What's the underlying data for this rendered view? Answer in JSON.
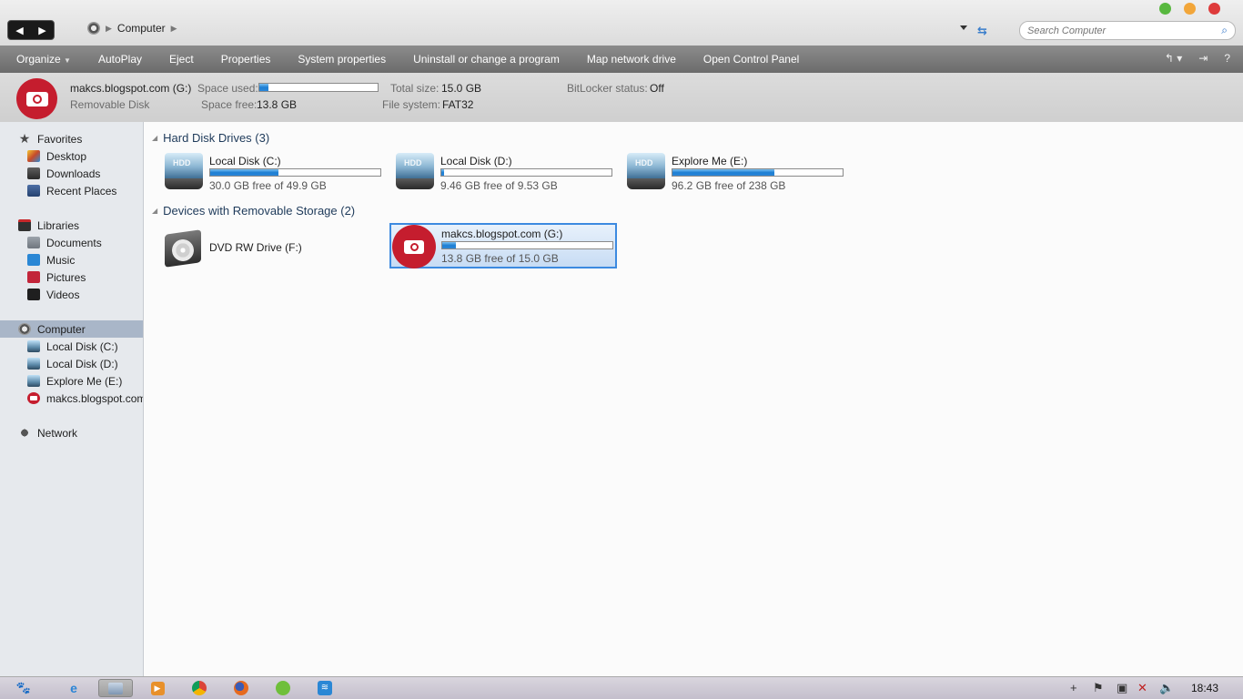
{
  "address": {
    "crumbs": [
      "Computer"
    ]
  },
  "search": {
    "placeholder": "Search Computer"
  },
  "window_buttons": {
    "colors": [
      "#58b83f",
      "#f2a63a",
      "#de3b3b"
    ]
  },
  "commands": [
    "Organize",
    "AutoPlay",
    "Eject",
    "Properties",
    "System properties",
    "Uninstall or change a program",
    "Map network drive",
    "Open Control Panel"
  ],
  "details": {
    "name": "makcs.blogspot.com (G:)",
    "type": "Removable Disk",
    "space_used_label": "Space used:",
    "space_used_fraction": 0.08,
    "space_free_label": "Space free:",
    "space_free_value": "13.8 GB",
    "total_size_label": "Total size:",
    "total_size_value": "15.0 GB",
    "filesystem_label": "File system:",
    "filesystem_value": "FAT32",
    "bitlocker_label": "BitLocker status:",
    "bitlocker_value": "Off"
  },
  "sidebar": {
    "favorites": "Favorites",
    "favorites_items": [
      "Desktop",
      "Downloads",
      "Recent Places"
    ],
    "libraries": "Libraries",
    "libraries_items": [
      "Documents",
      "Music",
      "Pictures",
      "Videos"
    ],
    "computer": "Computer",
    "computer_items": [
      "Local Disk (C:)",
      "Local Disk (D:)",
      "Explore Me (E:)",
      "makcs.blogspot.com"
    ],
    "network": "Network"
  },
  "groups": {
    "hdd_title": "Hard Disk Drives (3)",
    "removable_title": "Devices with Removable Storage (2)"
  },
  "drives": [
    {
      "name": "Local Disk (C:)",
      "free_text": "30.0 GB free of 49.9 GB",
      "used_fraction": 0.4
    },
    {
      "name": "Local Disk (D:)",
      "free_text": "9.46 GB free of 9.53 GB",
      "used_fraction": 0.01
    },
    {
      "name": "Explore Me (E:)",
      "free_text": "96.2 GB free of 238 GB",
      "used_fraction": 0.6
    }
  ],
  "removable": [
    {
      "name": "DVD RW Drive (F:)"
    },
    {
      "name": "makcs.blogspot.com (G:)",
      "free_text": "13.8 GB free of 15.0 GB",
      "used_fraction": 0.08
    }
  ],
  "taskbar": {
    "clock": "18:43"
  }
}
